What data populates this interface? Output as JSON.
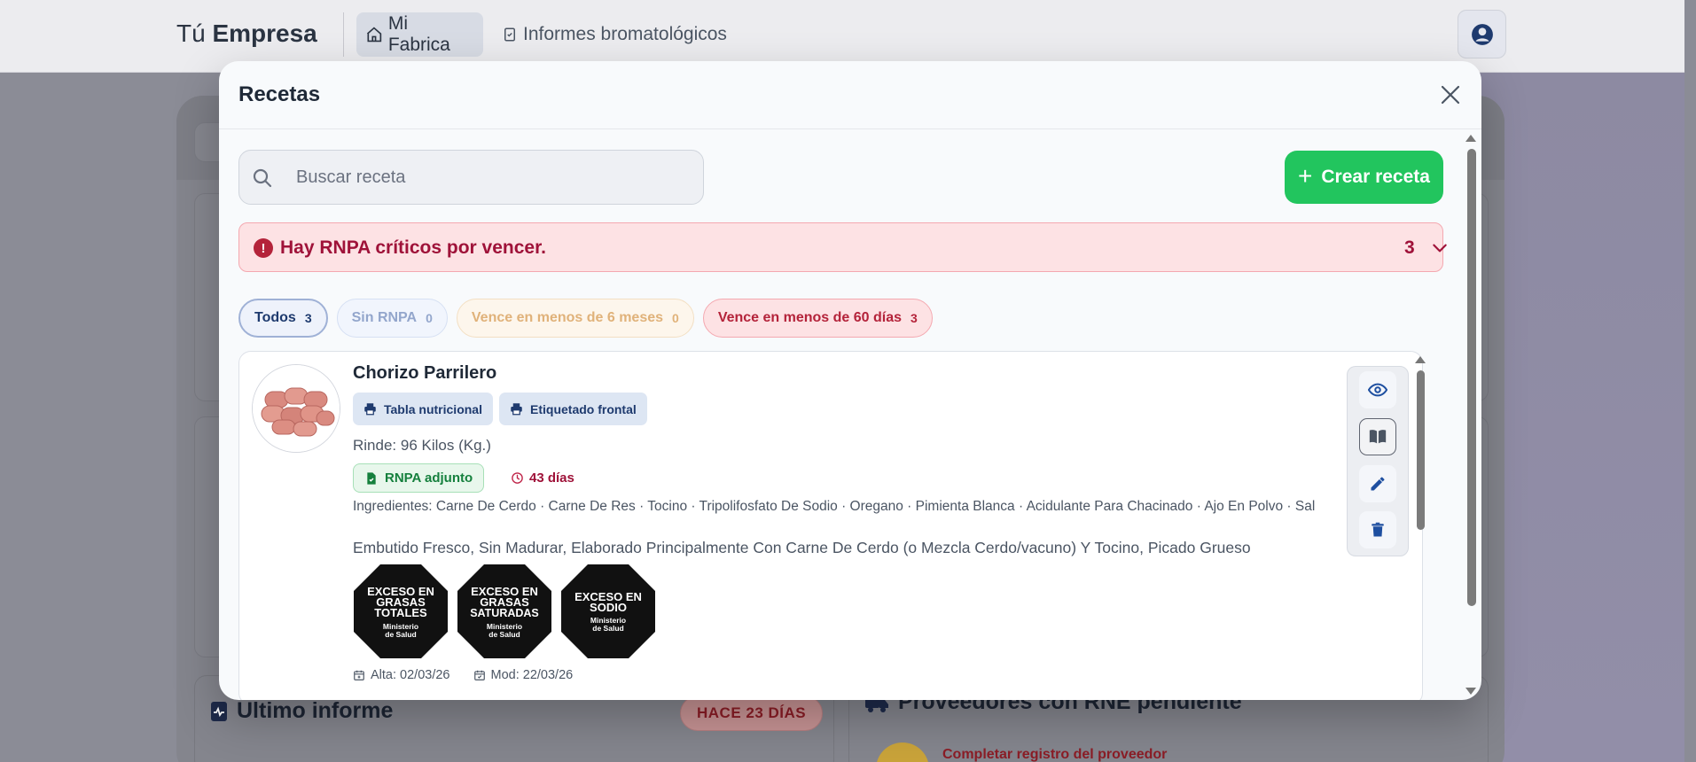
{
  "header": {
    "brand_light": "Tú",
    "brand_bold": "Empresa",
    "nav": [
      {
        "label": "Mi Fabrica",
        "icon": "home-icon",
        "active": true
      },
      {
        "label": "Informes bromatológicos",
        "icon": "clipboard-check-icon",
        "active": false
      }
    ],
    "user_icon": "user-circle-icon"
  },
  "background": {
    "ultimo_informe_title": "Ultimo informe",
    "ultimo_informe_badge": "HACE 23 DÍAS",
    "proveedores_title": "Proveedores con RNE pendiente",
    "proveedor_link": "Completar registro del proveedor"
  },
  "modal": {
    "title": "Recetas",
    "search": {
      "placeholder": "Buscar receta",
      "value": ""
    },
    "create_label": "Crear receta",
    "alert": {
      "text": "Hay RNPA críticos por vencer.",
      "count": "3"
    },
    "filters": [
      {
        "label": "Todos",
        "count": "3"
      },
      {
        "label": "Sin RNPA",
        "count": "0"
      },
      {
        "label": "Vence en menos de 6 meses",
        "count": "0"
      },
      {
        "label": "Vence en menos de 60 días",
        "count": "3"
      }
    ],
    "recipe": {
      "name": "Chorizo Parrilero",
      "print_buttons": [
        "Tabla nutricional",
        "Etiquetado frontal"
      ],
      "yield": "Rinde: 96 Kilos (Kg.)",
      "rnpa_label": "RNPA adjunto",
      "days_left": "43 días",
      "ingredients": "Ingredientes: Carne De Cerdo · Carne De Res · Tocino · Tripolifosfato De Sodio · Oregano · Pimienta Blanca · Acidulante Para Chacinado · Ajo En Polvo · Sal",
      "description": "Embutido Fresco, Sin Madurar, Elaborado Principalmente Con Carne De Cerdo (o Mezcla Cerdo/vacuno) Y Tocino, Picado Grueso",
      "seals": [
        {
          "lines": [
            "EXCESO EN",
            "GRASAS",
            "TOTALES"
          ],
          "footer": [
            "Ministerio",
            "de Salud"
          ]
        },
        {
          "lines": [
            "EXCESO EN",
            "GRASAS",
            "SATURADAS"
          ],
          "footer": [
            "Ministerio",
            "de Salud"
          ]
        },
        {
          "lines": [
            "EXCESO EN",
            "SODIO"
          ],
          "footer": [
            "Ministerio",
            "de Salud"
          ]
        }
      ],
      "created": "Alta: 02/03/26",
      "modified": "Mod: 22/03/26",
      "actions": [
        "eye-icon",
        "book-icon",
        "pencil-icon",
        "trash-icon"
      ]
    }
  },
  "colors": {
    "primary_green": "#22c55e",
    "alert_red": "#9f1239",
    "navy": "#1e3a6e"
  }
}
